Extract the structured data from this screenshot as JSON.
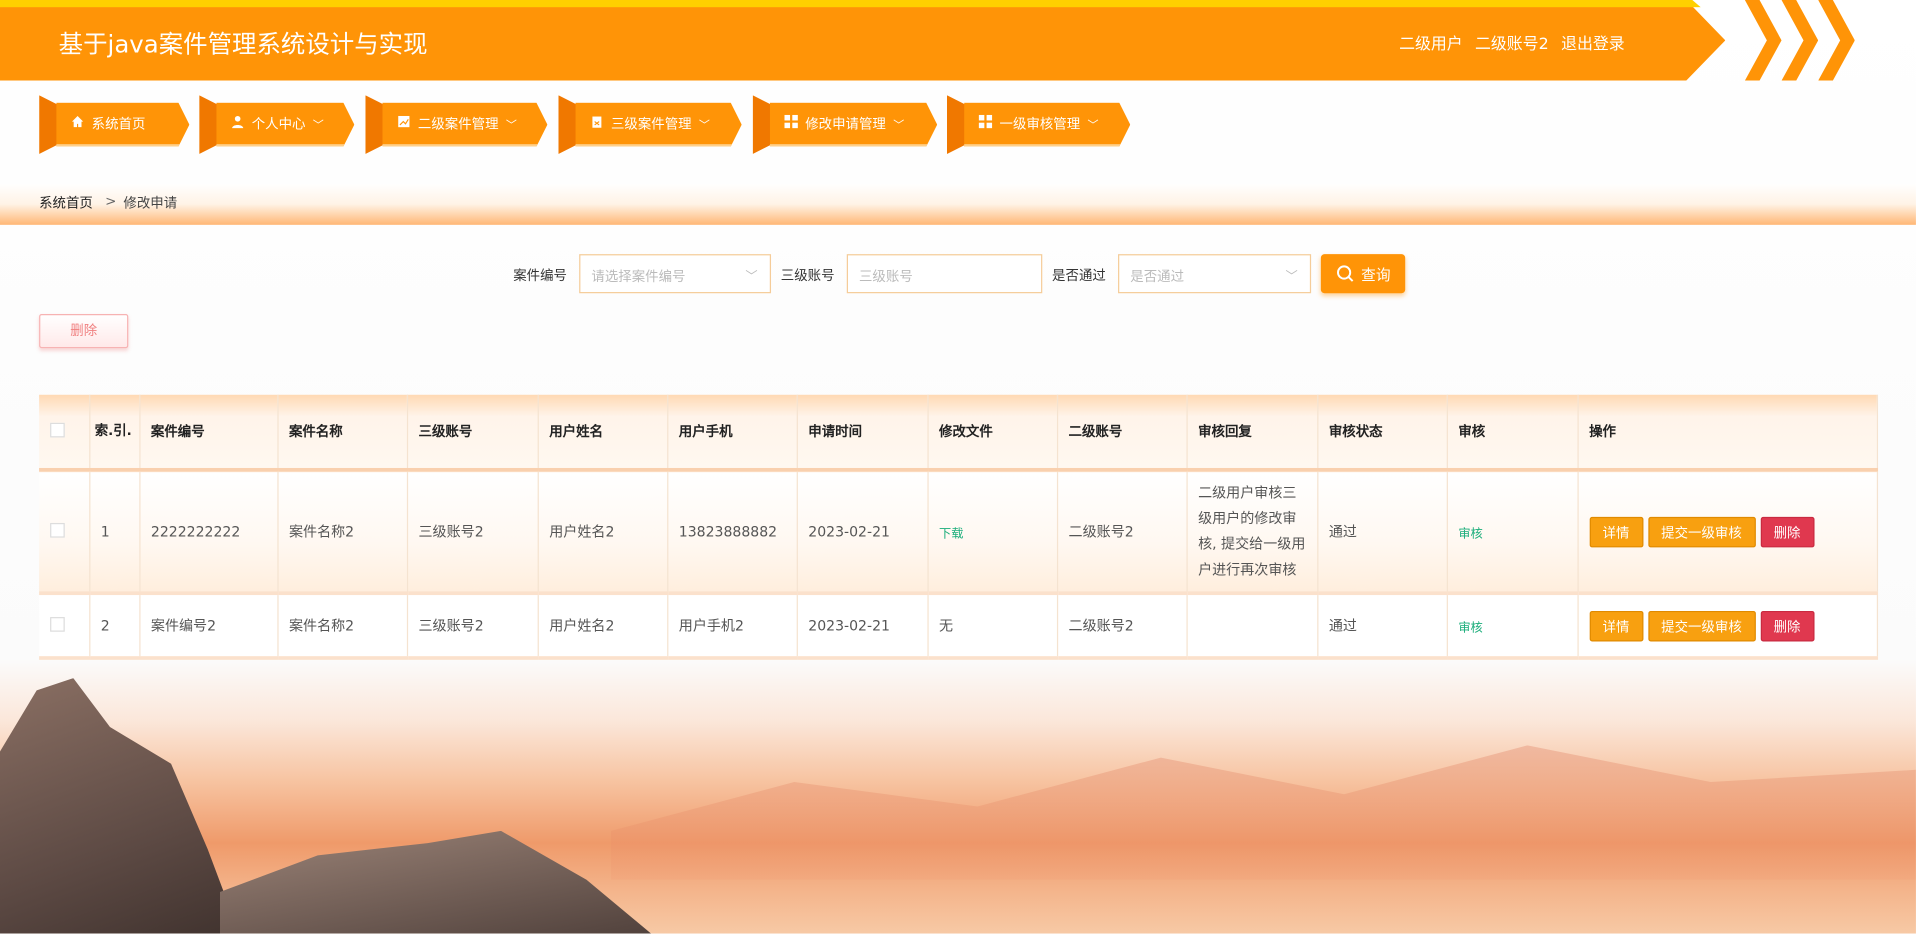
{
  "header": {
    "title": "基于java案件管理系统设计与实现",
    "role": "二级用户",
    "account": "二级账号2",
    "logout": "退出登录"
  },
  "nav": [
    {
      "label": "系统首页",
      "icon": "home-icon",
      "dropdown": false
    },
    {
      "label": "个人中心",
      "icon": "user-icon",
      "dropdown": true
    },
    {
      "label": "二级案件管理",
      "icon": "chart-icon",
      "dropdown": true
    },
    {
      "label": "三级案件管理",
      "icon": "clipboard-icon",
      "dropdown": true
    },
    {
      "label": "修改申请管理",
      "icon": "grid-icon",
      "dropdown": true
    },
    {
      "label": "一级审核管理",
      "icon": "grid-icon",
      "dropdown": true
    }
  ],
  "breadcrumb": {
    "home": "系统首页",
    "sep": ">",
    "current": "修改申请"
  },
  "search": {
    "case_no_label": "案件编号",
    "case_no_placeholder": "请选择案件编号",
    "account_label": "三级账号",
    "account_placeholder": "三级账号",
    "pass_label": "是否通过",
    "pass_placeholder": "是否通过",
    "query": "查询"
  },
  "delete_label": "删除",
  "table": {
    "headers": [
      "索.引.",
      "案件编号",
      "案件名称",
      "三级账号",
      "用户姓名",
      "用户手机",
      "申请时间",
      "修改文件",
      "二级账号",
      "审核回复",
      "审核状态",
      "审核",
      "操作"
    ],
    "rows": [
      {
        "index": "1",
        "case_no": "2222222222",
        "case_name": "案件名称2",
        "account3": "三级账号2",
        "name": "用户姓名2",
        "phone": "13823888882",
        "date": "2023-02-21",
        "file": "下载",
        "account2": "二级账号2",
        "reply": "二级用户审核三级用户的修改审核, 提交给一级用户进行再次审核",
        "status": "通过",
        "audit": "审核"
      },
      {
        "index": "2",
        "case_no": "案件编号2",
        "case_name": "案件名称2",
        "account3": "三级账号2",
        "name": "用户姓名2",
        "phone": "用户手机2",
        "date": "2023-02-21",
        "file": "无",
        "account2": "二级账号2",
        "reply": "",
        "status": "通过",
        "audit": "审核"
      }
    ],
    "actions": {
      "detail": "详情",
      "submit": "提交一级审核",
      "delete": "删除"
    }
  },
  "colors": {
    "primary": "#ff9407",
    "danger": "#e0384f",
    "link": "#1aad7a"
  }
}
